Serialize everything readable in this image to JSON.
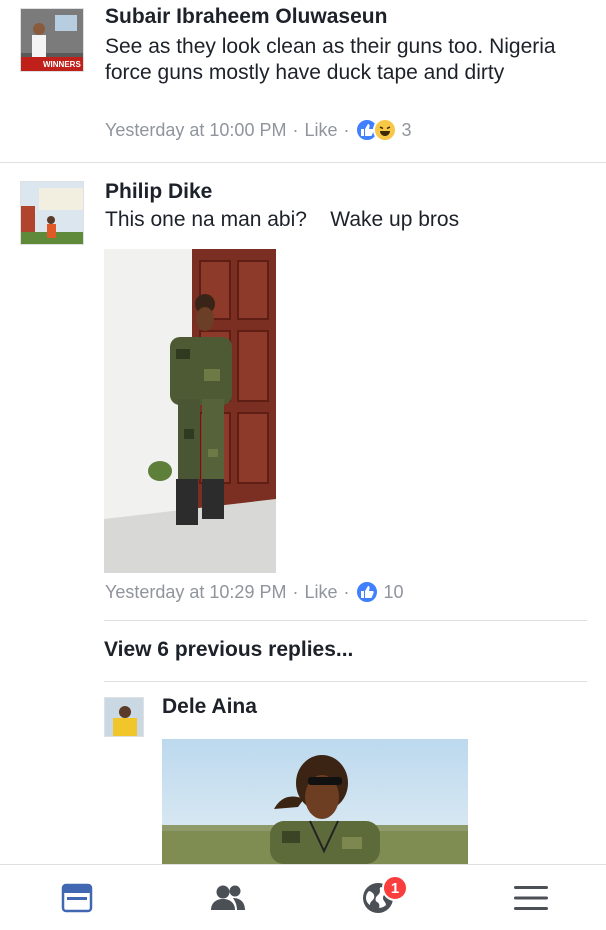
{
  "comments": [
    {
      "author": "Subair Ibraheem Oluwaseun",
      "text": "See as they look clean as their guns too. Nigeria force guns mostly have duck tape and dirty",
      "time": "Yesterday at 10:00 PM",
      "like_label": "Like",
      "separator": "·",
      "reaction_count": "3",
      "avatar_caption": "WINNERS"
    },
    {
      "author": "Philip Dike",
      "text": "This one na man abi?    Wake up bros",
      "time": "Yesterday at 10:29 PM",
      "like_label": "Like",
      "separator": "·",
      "reaction_count": "10"
    }
  ],
  "view_replies": "View 6 previous replies...",
  "reply": {
    "author": "Dele Aina"
  },
  "tabbar": {
    "notifications_badge": "1",
    "active_color": "#4267b2",
    "inactive_color": "#4b4f56"
  }
}
